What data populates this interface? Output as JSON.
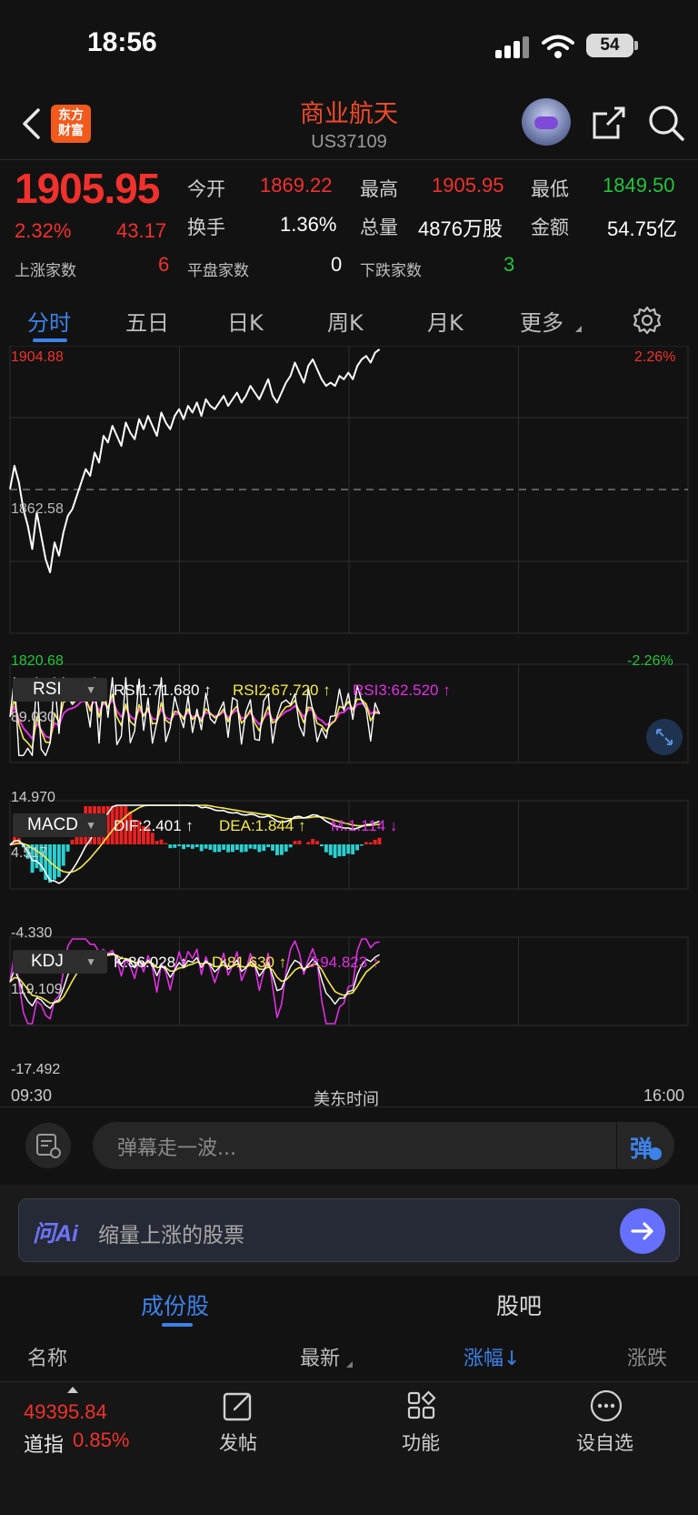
{
  "status_bar": {
    "time": "18:56",
    "battery": "54"
  },
  "header": {
    "title": "商业航天",
    "code": "US37109",
    "logo_text": "东方财富"
  },
  "quote": {
    "price": "1905.95",
    "change_pct": "2.32%",
    "change_abs": "43.17",
    "open_label": "今开",
    "open": "1869.22",
    "high_label": "最高",
    "high": "1905.95",
    "low_label": "最低",
    "low": "1849.50",
    "turnover_label": "换手",
    "turnover": "1.36%",
    "volume_label": "总量",
    "volume": "4876万股",
    "amount_label": "金额",
    "amount": "54.75亿",
    "up_label": "上涨家数",
    "up_count": "6",
    "flat_label": "平盘家数",
    "flat_count": "0",
    "down_label": "下跌家数",
    "down_count": "3"
  },
  "tabs": [
    "分时",
    "五日",
    "日K",
    "周K",
    "月K",
    "更多"
  ],
  "colors": {
    "up": "#f2312c",
    "down": "#22c53a",
    "accent": "#3d82e8",
    "yellow": "#f5e94a",
    "magenta": "#e030e0"
  },
  "chart_data": {
    "type": "line",
    "price_axis": {
      "top": "1904.88",
      "mid": "1862.58",
      "bottom": "1820.68",
      "top_pct": "2.26%",
      "bottom_pct": "-2.26%"
    },
    "x_labels": {
      "start": "09:30",
      "mid": "美东时间",
      "end": "16:00"
    },
    "price_series": [
      1864,
      1871,
      1866,
      1858,
      1853,
      1846,
      1857,
      1850,
      1843,
      1839,
      1848,
      1844,
      1851,
      1856,
      1858,
      1862,
      1866,
      1870,
      1868,
      1875,
      1872,
      1880,
      1878,
      1883,
      1880,
      1877,
      1884,
      1881,
      1879,
      1885,
      1882,
      1886,
      1883,
      1880,
      1887,
      1884,
      1882,
      1886,
      1888,
      1885,
      1889,
      1887,
      1890,
      1886,
      1891,
      1889,
      1888,
      1890,
      1892,
      1889,
      1891,
      1893,
      1890,
      1892,
      1895,
      1893,
      1891,
      1894,
      1897,
      1892,
      1890,
      1893,
      1896,
      1898,
      1902,
      1899,
      1896,
      1901,
      1903,
      1900,
      1897,
      1895,
      1896,
      1895,
      1898,
      1897,
      1899,
      1897,
      1901,
      1903,
      1904,
      1902,
      1905,
      1906
    ],
    "rsi": {
      "label": "RSI",
      "rsi1": "RSI1:71.680 ↑",
      "rsi2": "RSI2:67.720 ↑",
      "rsi3": "RSI3:62.520 ↑",
      "max": "89.030",
      "min": "14.970"
    },
    "macd": {
      "label": "MACD",
      "dif": "DIF:2.401 ↑",
      "dea": "DEA:1.844 ↑",
      "m": "M:1.114 ↓",
      "max": "4.517",
      "min": "-4.330"
    },
    "kdj": {
      "label": "KDJ",
      "k": "K:86.028 ↑",
      "d": "D:81.630 ↑",
      "j": "J:94.823 ↑",
      "max": "119.109",
      "min": "-17.492"
    }
  },
  "danmu": {
    "placeholder": "弹幕走一波...",
    "button": "弹"
  },
  "ai": {
    "logo": "问Ai",
    "prompt": "缩量上涨的股票"
  },
  "sections": {
    "tab1": "成份股",
    "tab2": "股吧"
  },
  "table_head": {
    "name": "名称",
    "latest": "最新",
    "change_pct": "涨幅↓",
    "change": "涨跌"
  },
  "bottom": {
    "index_value": "49395.84",
    "index_name": "道指",
    "index_pct": "0.85%",
    "post": "发帖",
    "function": "功能",
    "watchlist": "设自选"
  }
}
